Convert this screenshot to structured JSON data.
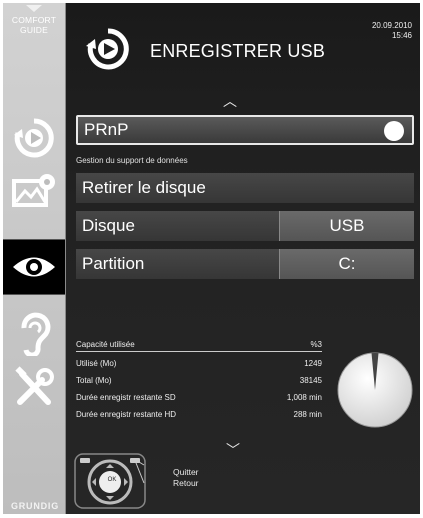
{
  "sidebar": {
    "comfort_guide_line1": "COMFORT",
    "comfort_guide_line2": "GUIDE",
    "brand": "GRUNDIG"
  },
  "header": {
    "date": "20.09.2010",
    "time": "15:46",
    "title": "ENREGISTRER USB"
  },
  "menu": {
    "prnp_label": "PRnP",
    "section_label": "Gestion du support de données",
    "remove_label": "Retirer le disque",
    "disk_label": "Disque",
    "disk_value": "USB",
    "partition_label": "Partition",
    "partition_value": "C:"
  },
  "stats": {
    "header_label": "Capacité utilisée",
    "header_value": "%3",
    "rows": [
      {
        "label": "Utilisé (Mo)",
        "value": "1249"
      },
      {
        "label": "Total (Mo)",
        "value": "38145"
      },
      {
        "label": "Durée enregistr restante SD",
        "value": "1,008 min"
      },
      {
        "label": "Durée enregistr restante HD",
        "value": "288 min"
      }
    ],
    "used_fraction": 0.03
  },
  "legend": {
    "quit": "Quitter",
    "back": "Retour",
    "ok": "OK"
  },
  "colors": {
    "background": "#222222",
    "accent": "#ffffff",
    "sidebar": "#c8c8c8",
    "pie_used": "#444444"
  }
}
